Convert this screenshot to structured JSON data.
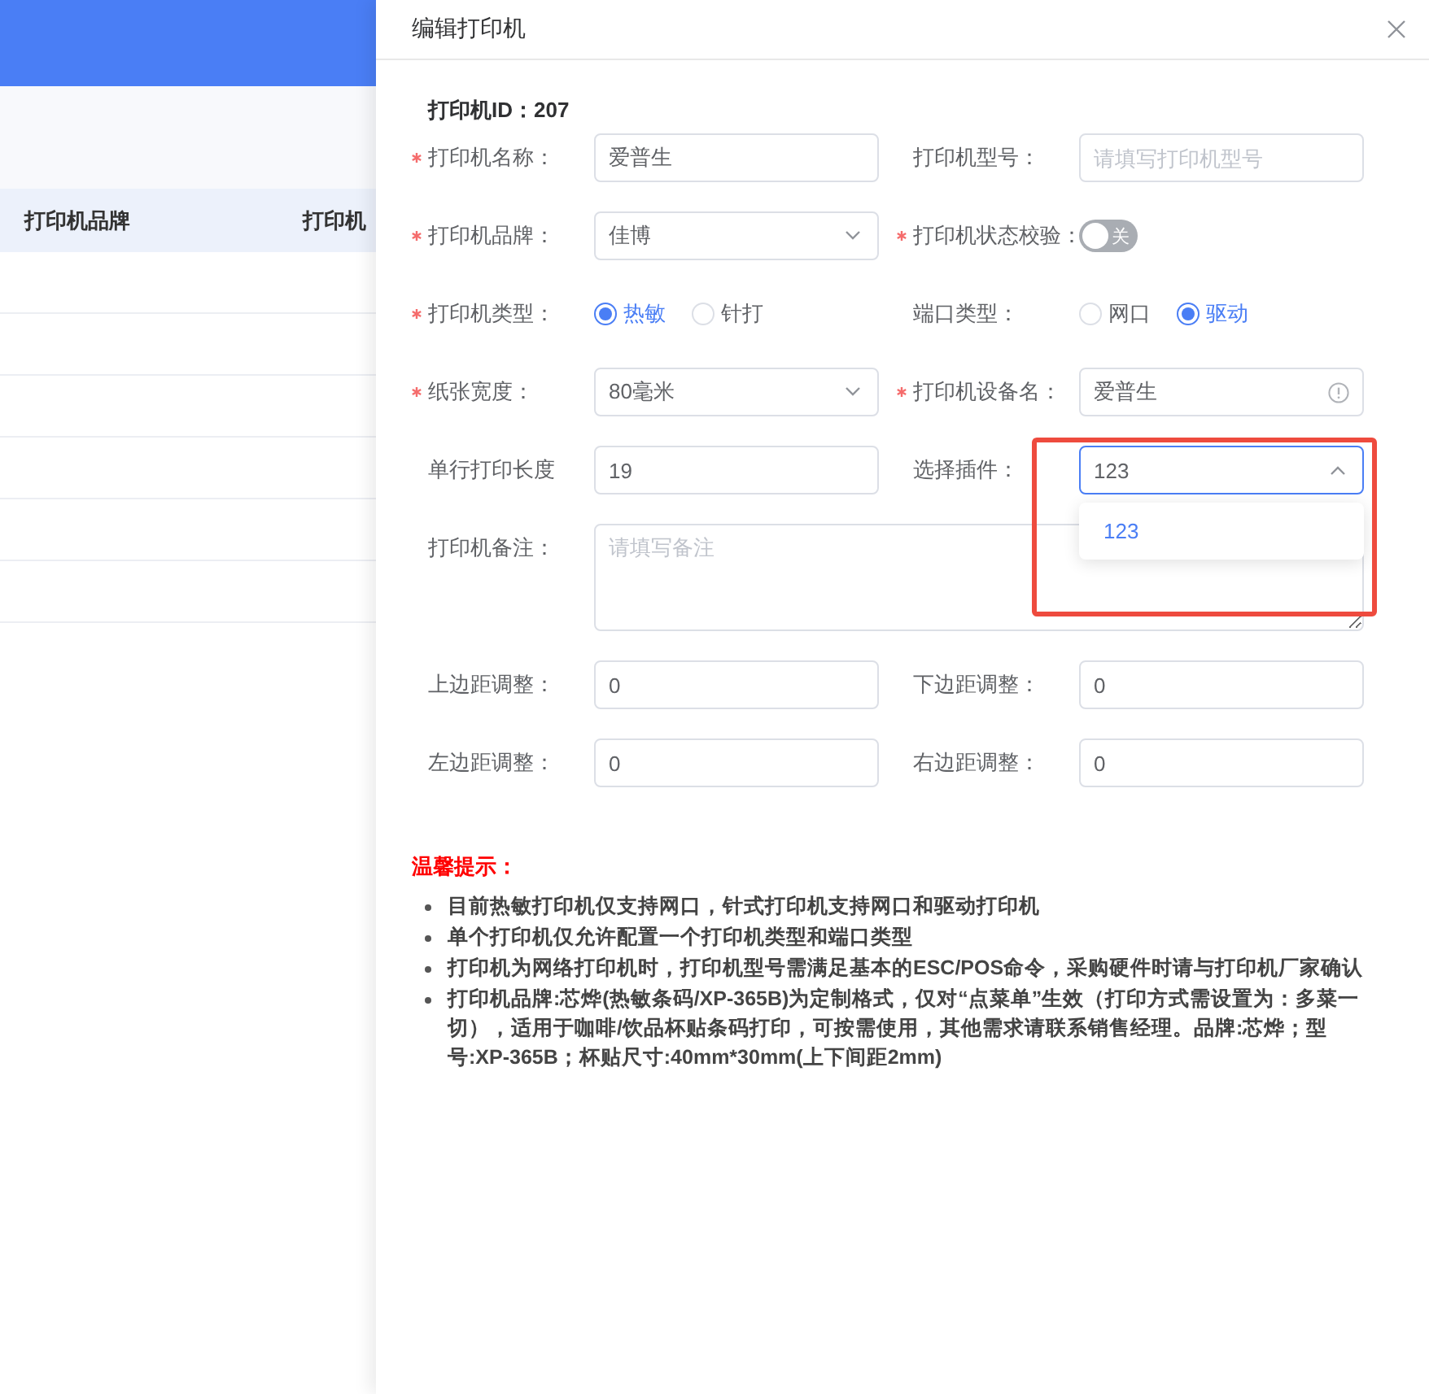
{
  "background": {
    "table_columns": [
      "打印机品牌",
      "打印机"
    ]
  },
  "drawer": {
    "title": "编辑打印机",
    "printer_id": "打印机ID：207",
    "rows": [
      [
        {
          "kind": "input",
          "label": "打印机名称：",
          "required": true,
          "value": "爱普生"
        },
        {
          "kind": "input",
          "label": "打印机型号：",
          "required": false,
          "placeholder": "请填写打印机型号"
        }
      ],
      [
        {
          "kind": "select",
          "label": "打印机品牌：",
          "required": true,
          "value": "佳博",
          "expanded": false
        },
        {
          "kind": "switch",
          "label": "打印机状态校验：",
          "required": true,
          "on": false,
          "text": "关"
        }
      ],
      [
        {
          "kind": "radio",
          "label": "打印机类型：",
          "required": true,
          "options": [
            {
              "label": "热敏",
              "selected": true
            },
            {
              "label": "针打",
              "selected": false
            }
          ]
        },
        {
          "kind": "radio",
          "label": "端口类型：",
          "required": false,
          "options": [
            {
              "label": "网口",
              "selected": false
            },
            {
              "label": "驱动",
              "selected": true
            }
          ]
        }
      ],
      [
        {
          "kind": "select",
          "label": "纸张宽度：",
          "required": true,
          "value": "80毫米",
          "expanded": false
        },
        {
          "kind": "input_info",
          "label": "打印机设备名：",
          "required": true,
          "value": "爱普生"
        }
      ],
      [
        {
          "kind": "input",
          "label": "单行打印长度",
          "required": false,
          "value": "19"
        },
        {
          "kind": "select",
          "label": "选择插件：",
          "required": false,
          "value": "123",
          "expanded": true,
          "highlighted": true,
          "options": [
            {
              "label": "123",
              "selected": true
            }
          ]
        }
      ],
      [
        {
          "kind": "textarea",
          "label": "打印机备注：",
          "required": false,
          "placeholder": "请填写备注"
        }
      ],
      [
        {
          "kind": "input",
          "label": "上边距调整：",
          "required": false,
          "value": "0"
        },
        {
          "kind": "input",
          "label": "下边距调整：",
          "required": false,
          "value": "0"
        }
      ],
      [
        {
          "kind": "input",
          "label": "左边距调整：",
          "required": false,
          "value": "0"
        },
        {
          "kind": "input",
          "label": "右边距调整：",
          "required": false,
          "value": "0"
        }
      ]
    ],
    "notes": {
      "title": "温馨提示：",
      "items": [
        "目前热敏打印机仅支持网口，针式打印机支持网口和驱动打印机",
        "单个打印机仅允许配置一个打印机类型和端口类型",
        "打印机为网络打印机时，打印机型号需满足基本的ESC/POS命令，采购硬件时请与打印机厂家确认",
        "打印机品牌:芯烨(热敏条码/XP-365B)为定制格式，仅对“点菜单”生效（打印方式需设置为：多菜一切），适用于咖啡/饮品杯贴条码打印，可按需使用，其他需求请联系销售经理。品牌:芯烨；型号:XP-365B；杯贴尺寸:40mm*30mm(上下间距2mm)"
      ]
    }
  }
}
